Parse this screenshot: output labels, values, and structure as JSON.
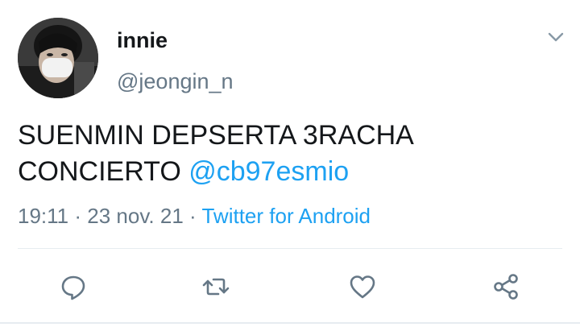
{
  "author": {
    "display_name": "innie",
    "handle": "@jeongin_n",
    "avatar_icon": "profile-avatar"
  },
  "tweet": {
    "text_prefix": "SUENMIN DEPSERTA 3RACHA CONCIERTO ",
    "mention": "@cb97esmio",
    "time": "19:11",
    "date": "23 nov. 21",
    "separator": "·",
    "source": "Twitter for Android"
  },
  "actions": [
    {
      "name": "reply",
      "icon": "reply-icon"
    },
    {
      "name": "retweet",
      "icon": "retweet-icon"
    },
    {
      "name": "like",
      "icon": "heart-icon"
    },
    {
      "name": "share",
      "icon": "share-icon"
    }
  ],
  "colors": {
    "accent": "#1da1f2",
    "secondary_text": "#657786",
    "primary_text": "#14171a",
    "icon_gray": "#657786",
    "divider": "#e6ecf0"
  }
}
